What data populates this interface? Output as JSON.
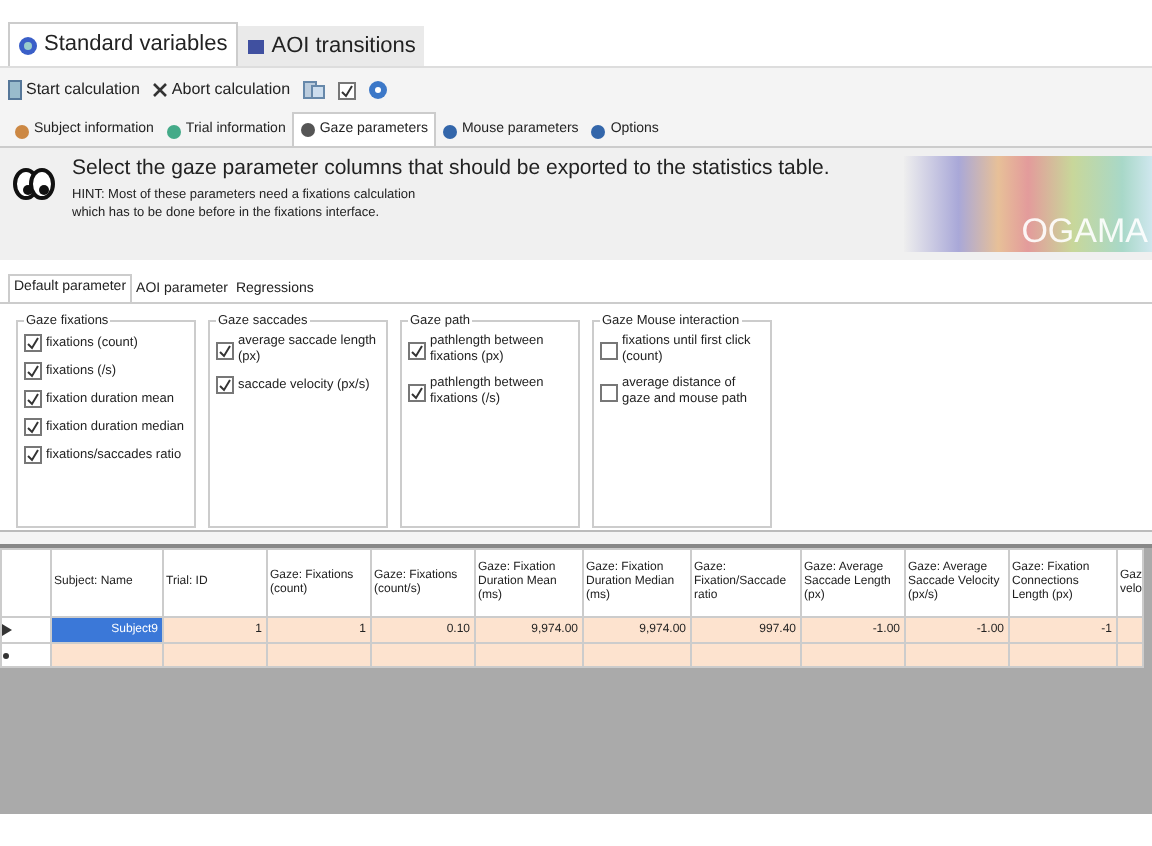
{
  "main_tabs": [
    {
      "label": "Standard variables",
      "selected": true
    },
    {
      "label": "AOI transitions",
      "selected": false
    }
  ],
  "toolbar": [
    {
      "kind": "button",
      "label": "Start calculation"
    },
    {
      "kind": "button",
      "label": "Abort calculation"
    },
    {
      "kind": "icon"
    },
    {
      "kind": "check",
      "checked": true
    },
    {
      "kind": "help"
    }
  ],
  "sub_tabs": [
    {
      "label": "Subject information",
      "selected": false
    },
    {
      "label": "Trial information",
      "selected": false
    },
    {
      "label": "Gaze parameters",
      "selected": true
    },
    {
      "label": "Mouse parameters",
      "selected": false
    },
    {
      "label": "Options",
      "selected": false
    }
  ],
  "header": {
    "title": "Select the gaze parameter columns that should be exported to the statistics table.",
    "hint": "HINT: Most of these parameters need a fixations calculation which has to be done before in the fixations interface.",
    "logo": "OGAMA"
  },
  "param_tabs": [
    {
      "label": "Default parameter",
      "selected": true
    },
    {
      "label": "AOI parameter",
      "selected": false
    },
    {
      "label": "Regressions",
      "selected": false
    }
  ],
  "groups": [
    {
      "title": "Gaze fixations",
      "options": [
        {
          "label": "fixations (count)",
          "checked": true
        },
        {
          "label": "fixations (/s)",
          "checked": true
        },
        {
          "label": "fixation duration mean",
          "checked": true
        },
        {
          "label": "fixation duration median",
          "checked": true
        },
        {
          "label": "fixations/saccades ratio",
          "checked": true
        }
      ]
    },
    {
      "title": "Gaze saccades",
      "options": [
        {
          "label": "average saccade length (px)",
          "checked": true
        },
        {
          "label": "saccade velocity (px/s)",
          "checked": true
        }
      ]
    },
    {
      "title": "Gaze path",
      "options": [
        {
          "label": "pathlength between fixations (px)",
          "checked": true
        },
        {
          "label": "pathlength between fixations (/s)",
          "checked": true
        }
      ]
    },
    {
      "title": "Gaze Mouse interaction",
      "options": [
        {
          "label": "fixations until first click (count)",
          "checked": false
        },
        {
          "label": "average distance of gaze and mouse path",
          "checked": false
        }
      ]
    }
  ],
  "table": {
    "columns": [
      "Subject: Name",
      "Trial: ID",
      "Gaze: Fixations (count)",
      "Gaze: Fixations (count/s)",
      "Gaze: Fixation Duration Mean (ms)",
      "Gaze: Fixation Duration Median (ms)",
      "Gaze: Fixation/Saccade ratio",
      "Gaze: Average Saccade Length (px)",
      "Gaze: Average Saccade Velocity (px/s)",
      "Gaze: Fixation Connections Length (px)",
      "Gaz velo"
    ],
    "rows": [
      {
        "cells": [
          "Subject9",
          "1",
          "1",
          "0.10",
          "9,974.00",
          "9,974.00",
          "997.40",
          "-1.00",
          "-1.00",
          "-1",
          ""
        ],
        "current": true
      }
    ]
  }
}
